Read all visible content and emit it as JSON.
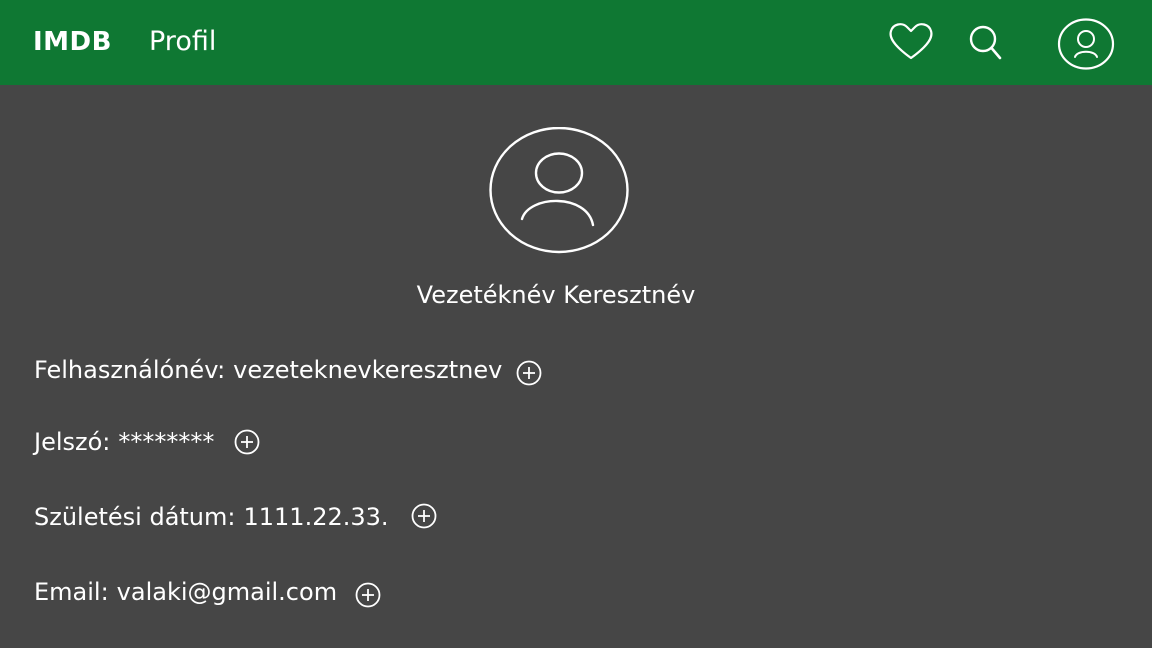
{
  "header": {
    "brand": "IMDB",
    "page_title": "Profil",
    "icons": [
      "heart-icon",
      "search-icon",
      "user-icon"
    ]
  },
  "profile": {
    "full_name": "Vezetéknév Keresztnév",
    "fields": [
      {
        "label": "Felhasználónév:",
        "value": "vezeteknevkeresztnev"
      },
      {
        "label": "Jelszó:",
        "value": "********"
      },
      {
        "label": "Születési dátum:",
        "value": "1111.22.33."
      },
      {
        "label": "Email:",
        "value": "valaki@gmail.com"
      }
    ]
  },
  "colors": {
    "header_bg": "#0f7833",
    "page_bg": "#464646",
    "text": "#ffffff"
  }
}
